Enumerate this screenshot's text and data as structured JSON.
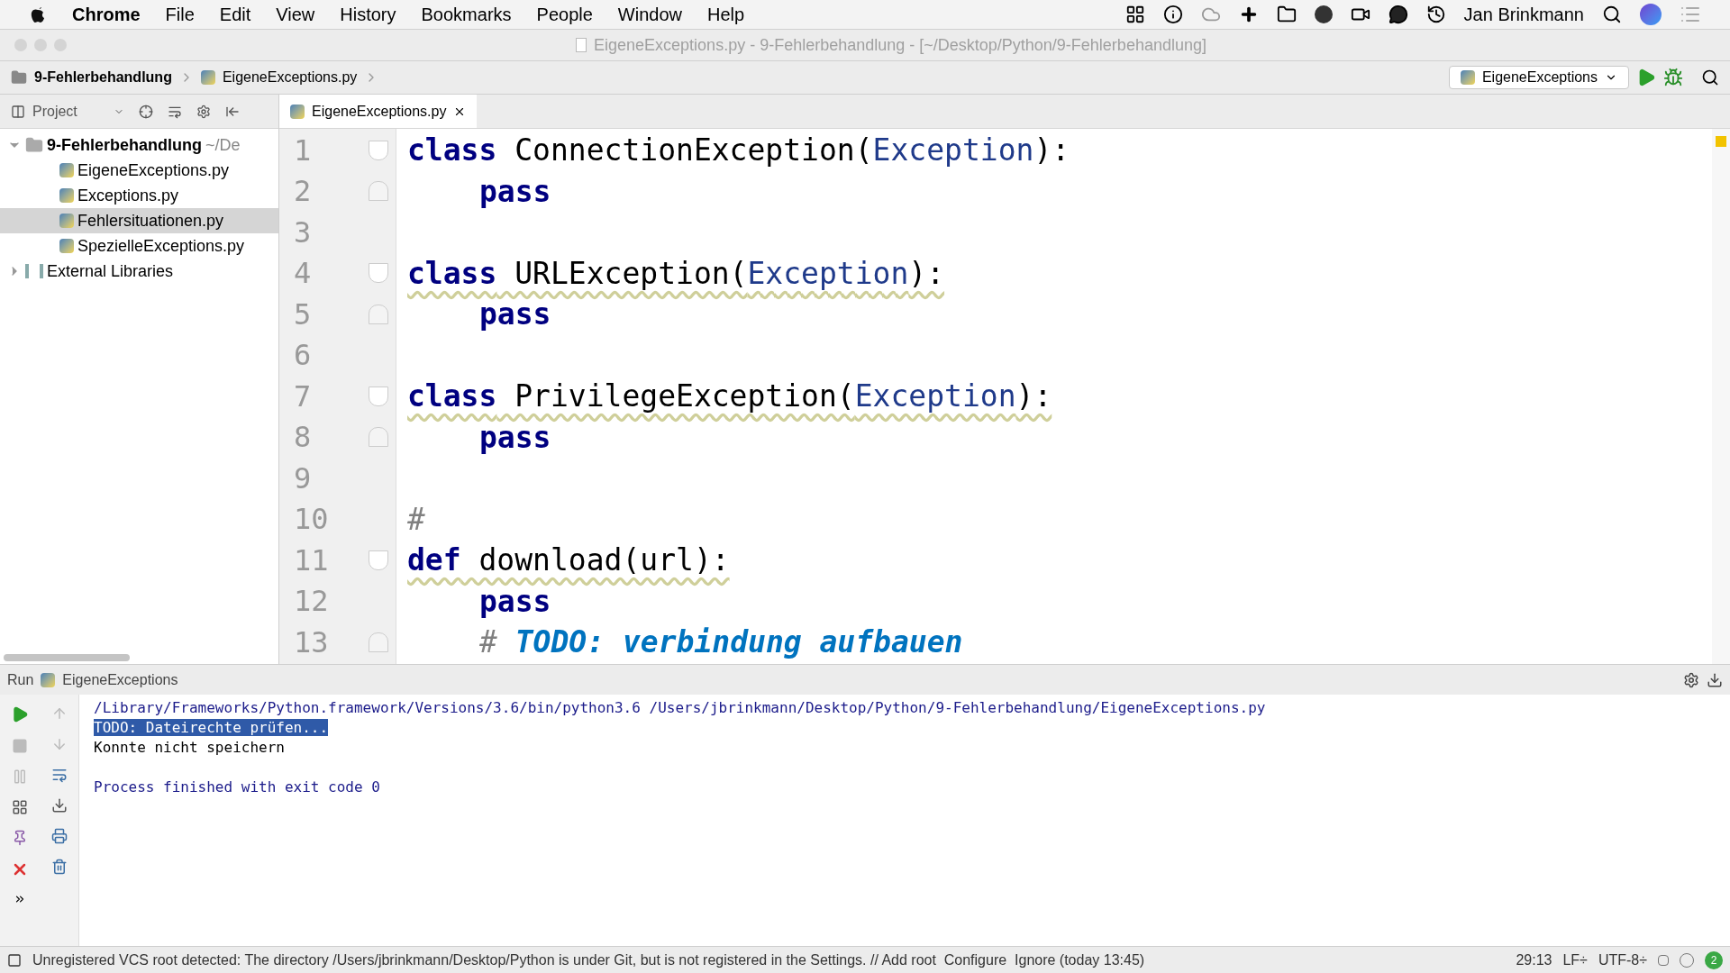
{
  "menu_bar": {
    "app": "Chrome",
    "items": [
      "File",
      "Edit",
      "View",
      "History",
      "Bookmarks",
      "People",
      "Window",
      "Help"
    ],
    "user": "Jan Brinkmann"
  },
  "window": {
    "title": "EigeneExceptions.py - 9-Fehlerbehandlung - [~/Desktop/Python/9-Fehlerbehandlung]"
  },
  "breadcrumbs": [
    "9-Fehlerbehandlung",
    "EigeneExceptions.py"
  ],
  "run_config": {
    "label": "EigeneExceptions"
  },
  "project_panel": {
    "label": "Project",
    "root": {
      "label": "9-Fehlerbehandlung",
      "path": "~/De",
      "expanded": true,
      "children": [
        {
          "label": "EigeneExceptions.py",
          "selected": false
        },
        {
          "label": "Exceptions.py",
          "selected": false
        },
        {
          "label": "Fehlersituationen.py",
          "selected": true
        },
        {
          "label": "SpezielleExceptions.py",
          "selected": false
        }
      ]
    },
    "external": {
      "label": "External Libraries",
      "expanded": false
    }
  },
  "tabs": [
    {
      "label": "EigeneExceptions.py",
      "selected": true
    }
  ],
  "editor": {
    "lines": [
      {
        "number": "1",
        "fold_marker": true,
        "fold_open": true,
        "indent": false,
        "warning": false,
        "tokens": [
          {
            "kind": "keyword",
            "text": "class"
          },
          {
            "kind": "plain",
            "text": " ConnectionException("
          },
          {
            "kind": "builtin",
            "text": "Exception"
          },
          {
            "kind": "plain",
            "text": "):"
          }
        ]
      },
      {
        "number": "2",
        "fold_marker": true,
        "fold_open": false,
        "indent": true,
        "warning": false,
        "tokens": [
          {
            "kind": "keyword",
            "text": "pass"
          }
        ]
      },
      {
        "number": "3",
        "fold_marker": false
      },
      {
        "number": "4",
        "fold_marker": true,
        "fold_open": true,
        "indent": false,
        "warning": true,
        "tokens": [
          {
            "kind": "keyword",
            "text": "class"
          },
          {
            "kind": "plain",
            "text": " URLException("
          },
          {
            "kind": "builtin",
            "text": "Exception"
          },
          {
            "kind": "plain",
            "text": "):"
          }
        ]
      },
      {
        "number": "5",
        "fold_marker": true,
        "fold_open": false,
        "indent": true,
        "warning": false,
        "tokens": [
          {
            "kind": "keyword",
            "text": "pass"
          }
        ]
      },
      {
        "number": "6",
        "fold_marker": false
      },
      {
        "number": "7",
        "fold_marker": true,
        "fold_open": true,
        "indent": false,
        "warning": true,
        "tokens": [
          {
            "kind": "keyword",
            "text": "class"
          },
          {
            "kind": "plain",
            "text": " PrivilegeException("
          },
          {
            "kind": "builtin",
            "text": "Exception"
          },
          {
            "kind": "plain",
            "text": "):"
          }
        ]
      },
      {
        "number": "8",
        "fold_marker": true,
        "fold_open": false,
        "indent": true,
        "warning": false,
        "tokens": [
          {
            "kind": "keyword",
            "text": "pass"
          }
        ]
      },
      {
        "number": "9",
        "fold_marker": false
      },
      {
        "number": "10",
        "fold_marker": false,
        "indent": false,
        "warning": false,
        "tokens": [
          {
            "kind": "comment",
            "text": "#"
          }
        ]
      },
      {
        "number": "11",
        "fold_marker": true,
        "fold_open": true,
        "indent": false,
        "warning": true,
        "tokens": [
          {
            "kind": "keyword",
            "text": "def"
          },
          {
            "kind": "plain",
            "text": " download(url):"
          }
        ]
      },
      {
        "number": "12",
        "fold_marker": false,
        "indent": true,
        "warning": false,
        "tokens": [
          {
            "kind": "keyword",
            "text": "pass"
          }
        ]
      },
      {
        "number": "13",
        "fold_marker": true,
        "fold_open": false,
        "indent": true,
        "warning": false,
        "tokens": [
          {
            "kind": "comment",
            "text": "#"
          },
          {
            "kind": "todo",
            "text": " TODO: verbindung aufbauen"
          }
        ]
      }
    ]
  },
  "run_panel": {
    "label": "Run",
    "config": "EigeneExceptions",
    "output": [
      {
        "kind": "command",
        "text": "/Library/Frameworks/Python.framework/Versions/3.6/bin/python3.6 /Users/jbrinkmann/Desktop/Python/9-Fehlerbehandlung/EigeneExceptions.py",
        "selected": false
      },
      {
        "kind": "stdout",
        "text": "TODO: Dateirechte prüfen...",
        "selected": true
      },
      {
        "kind": "stdout",
        "text": "Konnte nicht speichern",
        "selected": false
      },
      {
        "kind": "exit",
        "text": "Process finished with exit code 0",
        "selected": false
      }
    ]
  },
  "status_bar": {
    "message": "Unregistered VCS root detected: The directory /Users/jbrinkmann/Desktop/Python is under Git, but is not registered in the Settings. // Add root  Configure  Ignore (today 13:45)",
    "position": "29:13",
    "line_sep": "LF÷",
    "encoding": "UTF-8÷",
    "events": "2"
  }
}
